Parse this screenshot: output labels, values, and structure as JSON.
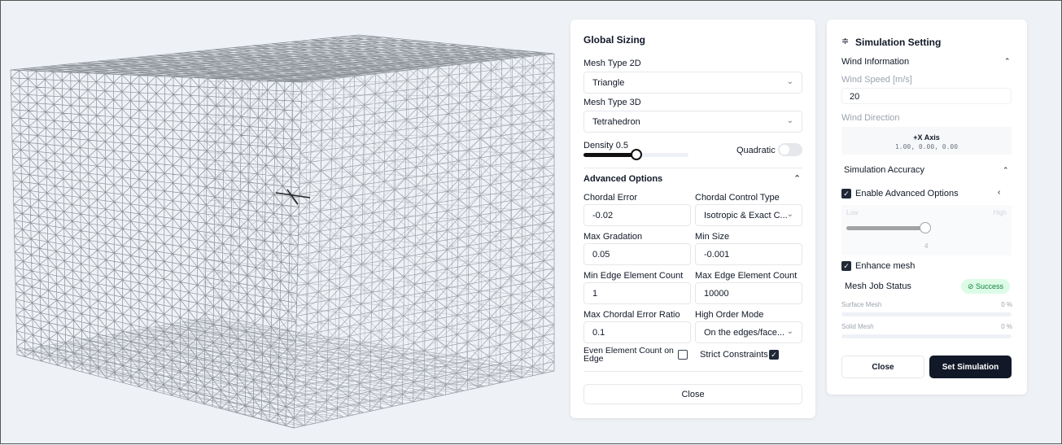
{
  "global_sizing": {
    "title": "Global Sizing",
    "mesh_type_2d_label": "Mesh Type 2D",
    "mesh_type_2d": "Triangle",
    "mesh_type_3d_label": "Mesh Type 3D",
    "mesh_type_3d": "Tetrahedron",
    "density_label": "Density 0.5",
    "density": 0.5,
    "quadratic_label": "Quadratic",
    "quadratic": false,
    "advanced_title": "Advanced Options",
    "chordal_error_label": "Chordal Error",
    "chordal_error": "-0.02",
    "chordal_control_label": "Chordal Control Type",
    "chordal_control": "Isotropic & Exact C...",
    "max_gradation_label": "Max Gradation",
    "max_gradation": "0.05",
    "min_size_label": "Min Size",
    "min_size": "-0.001",
    "min_edge_label": "Min Edge Element Count",
    "min_edge": "1",
    "max_edge_label": "Max Edge Element Count",
    "max_edge": "10000",
    "max_chordal_ratio_label": "Max Chordal Error Ratio",
    "max_chordal_ratio": "0.1",
    "high_order_label": "High Order Mode",
    "high_order": "On the edges/face...",
    "even_label": "Even Element Count on Edge",
    "even": false,
    "strict_label": "Strict Constraints",
    "strict": true,
    "close": "Close"
  },
  "simulation": {
    "title": "Simulation Setting",
    "wind_info": "Wind Information",
    "wind_speed_label": "Wind Speed [m/s]",
    "wind_speed": "20",
    "wind_dir_label": "Wind Direction",
    "wind_axis": "+X Axis",
    "wind_vector": "1.00, 0.00, 0.00",
    "accuracy": "Simulation Accuracy",
    "enable_adv": "Enable Advanced Options",
    "enable_adv_checked": true,
    "low": "Low",
    "high": "High",
    "accuracy_value": "4",
    "accuracy_fraction": 0.97,
    "enhance": "Enhance mesh",
    "enhance_checked": true,
    "job_status": "Mesh Job Status",
    "status": "Success",
    "surface": "Surface Mesh",
    "surface_pct": "0 %",
    "solid": "Solid Mesh",
    "solid_pct": "0 %",
    "close": "Close",
    "set": "Set Simulation"
  }
}
